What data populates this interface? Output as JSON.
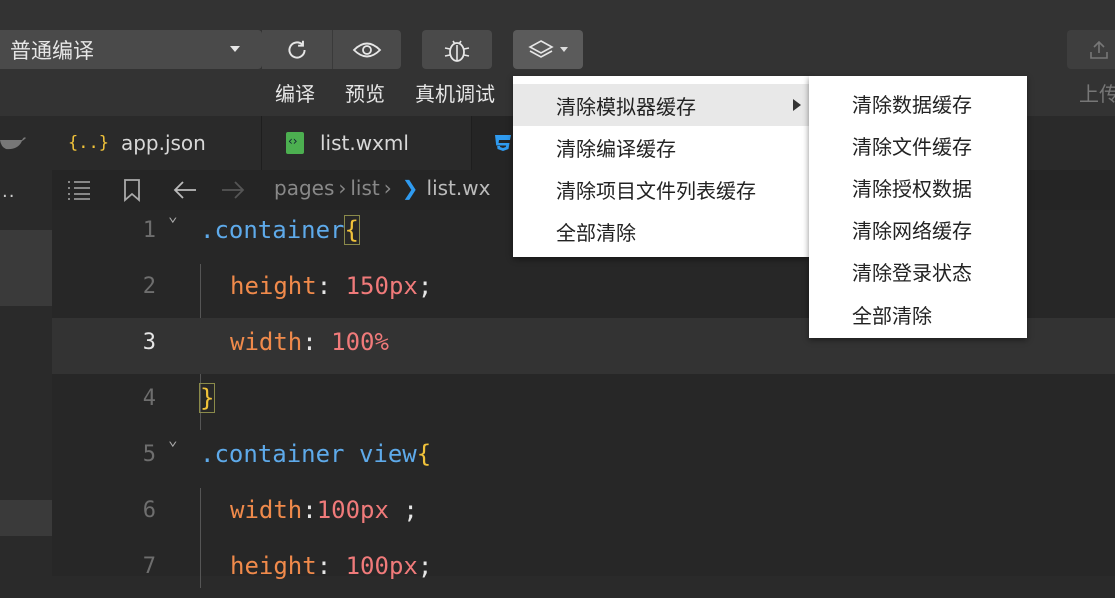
{
  "toolbar": {
    "compile_mode": "普通编译",
    "compile_label": "编译",
    "preview_label": "预览",
    "debug_label": "真机调试",
    "upload_label": "上传"
  },
  "tabs": [
    {
      "label": "app.json",
      "icon": "json-braces-icon"
    },
    {
      "label": "list.wxml",
      "icon": "wxml-file-icon"
    },
    {
      "label": "",
      "icon": "css-file-icon"
    }
  ],
  "breadcrumb": {
    "parts": [
      "pages",
      "list",
      "list.wx"
    ]
  },
  "editor": {
    "lines": [
      {
        "n": "1",
        "fold": true,
        "tokens": [
          {
            "t": ".container",
            "c": "c-sel"
          },
          {
            "t": "{",
            "c": "c-brace"
          }
        ]
      },
      {
        "n": "2",
        "fold": false,
        "tokens": [
          {
            "t": "height",
            "c": "c-prop"
          },
          {
            "t": ": ",
            "c": "c-punc"
          },
          {
            "t": "150px",
            "c": "c-num"
          },
          {
            "t": ";",
            "c": "c-punc"
          }
        ]
      },
      {
        "n": "3",
        "fold": false,
        "active": true,
        "tokens": [
          {
            "t": "width",
            "c": "c-prop"
          },
          {
            "t": ": ",
            "c": "c-punc"
          },
          {
            "t": "100%",
            "c": "c-num"
          }
        ]
      },
      {
        "n": "4",
        "fold": false,
        "tokens": [
          {
            "t": "}",
            "c": "c-brace"
          }
        ]
      },
      {
        "n": "5",
        "fold": true,
        "tokens": [
          {
            "t": ".container view",
            "c": "c-sel"
          },
          {
            "t": "{",
            "c": "c-brace"
          }
        ]
      },
      {
        "n": "6",
        "fold": false,
        "tokens": [
          {
            "t": "width",
            "c": "c-prop"
          },
          {
            "t": ":",
            "c": "c-punc"
          },
          {
            "t": "100px",
            "c": "c-num"
          },
          {
            "t": " ;",
            "c": "c-punc"
          }
        ]
      },
      {
        "n": "7",
        "fold": false,
        "tokens": [
          {
            "t": "height",
            "c": "c-prop"
          },
          {
            "t": ": ",
            "c": "c-punc"
          },
          {
            "t": "100px",
            "c": "c-num"
          },
          {
            "t": ";",
            "c": "c-punc"
          }
        ]
      }
    ]
  },
  "menu": {
    "items": [
      "清除模拟器缓存",
      "清除编译缓存",
      "清除项目文件列表缓存",
      "全部清除"
    ],
    "submenu": [
      "清除数据缓存",
      "清除文件缓存",
      "清除授权数据",
      "清除网络缓存",
      "清除登录状态",
      "全部清除"
    ]
  },
  "colors": {
    "accent_css": "#2f9bf0",
    "selector": "#5eaaea",
    "property": "#f08a4b",
    "number": "#f07a7a",
    "brace": "#f0c23a"
  }
}
